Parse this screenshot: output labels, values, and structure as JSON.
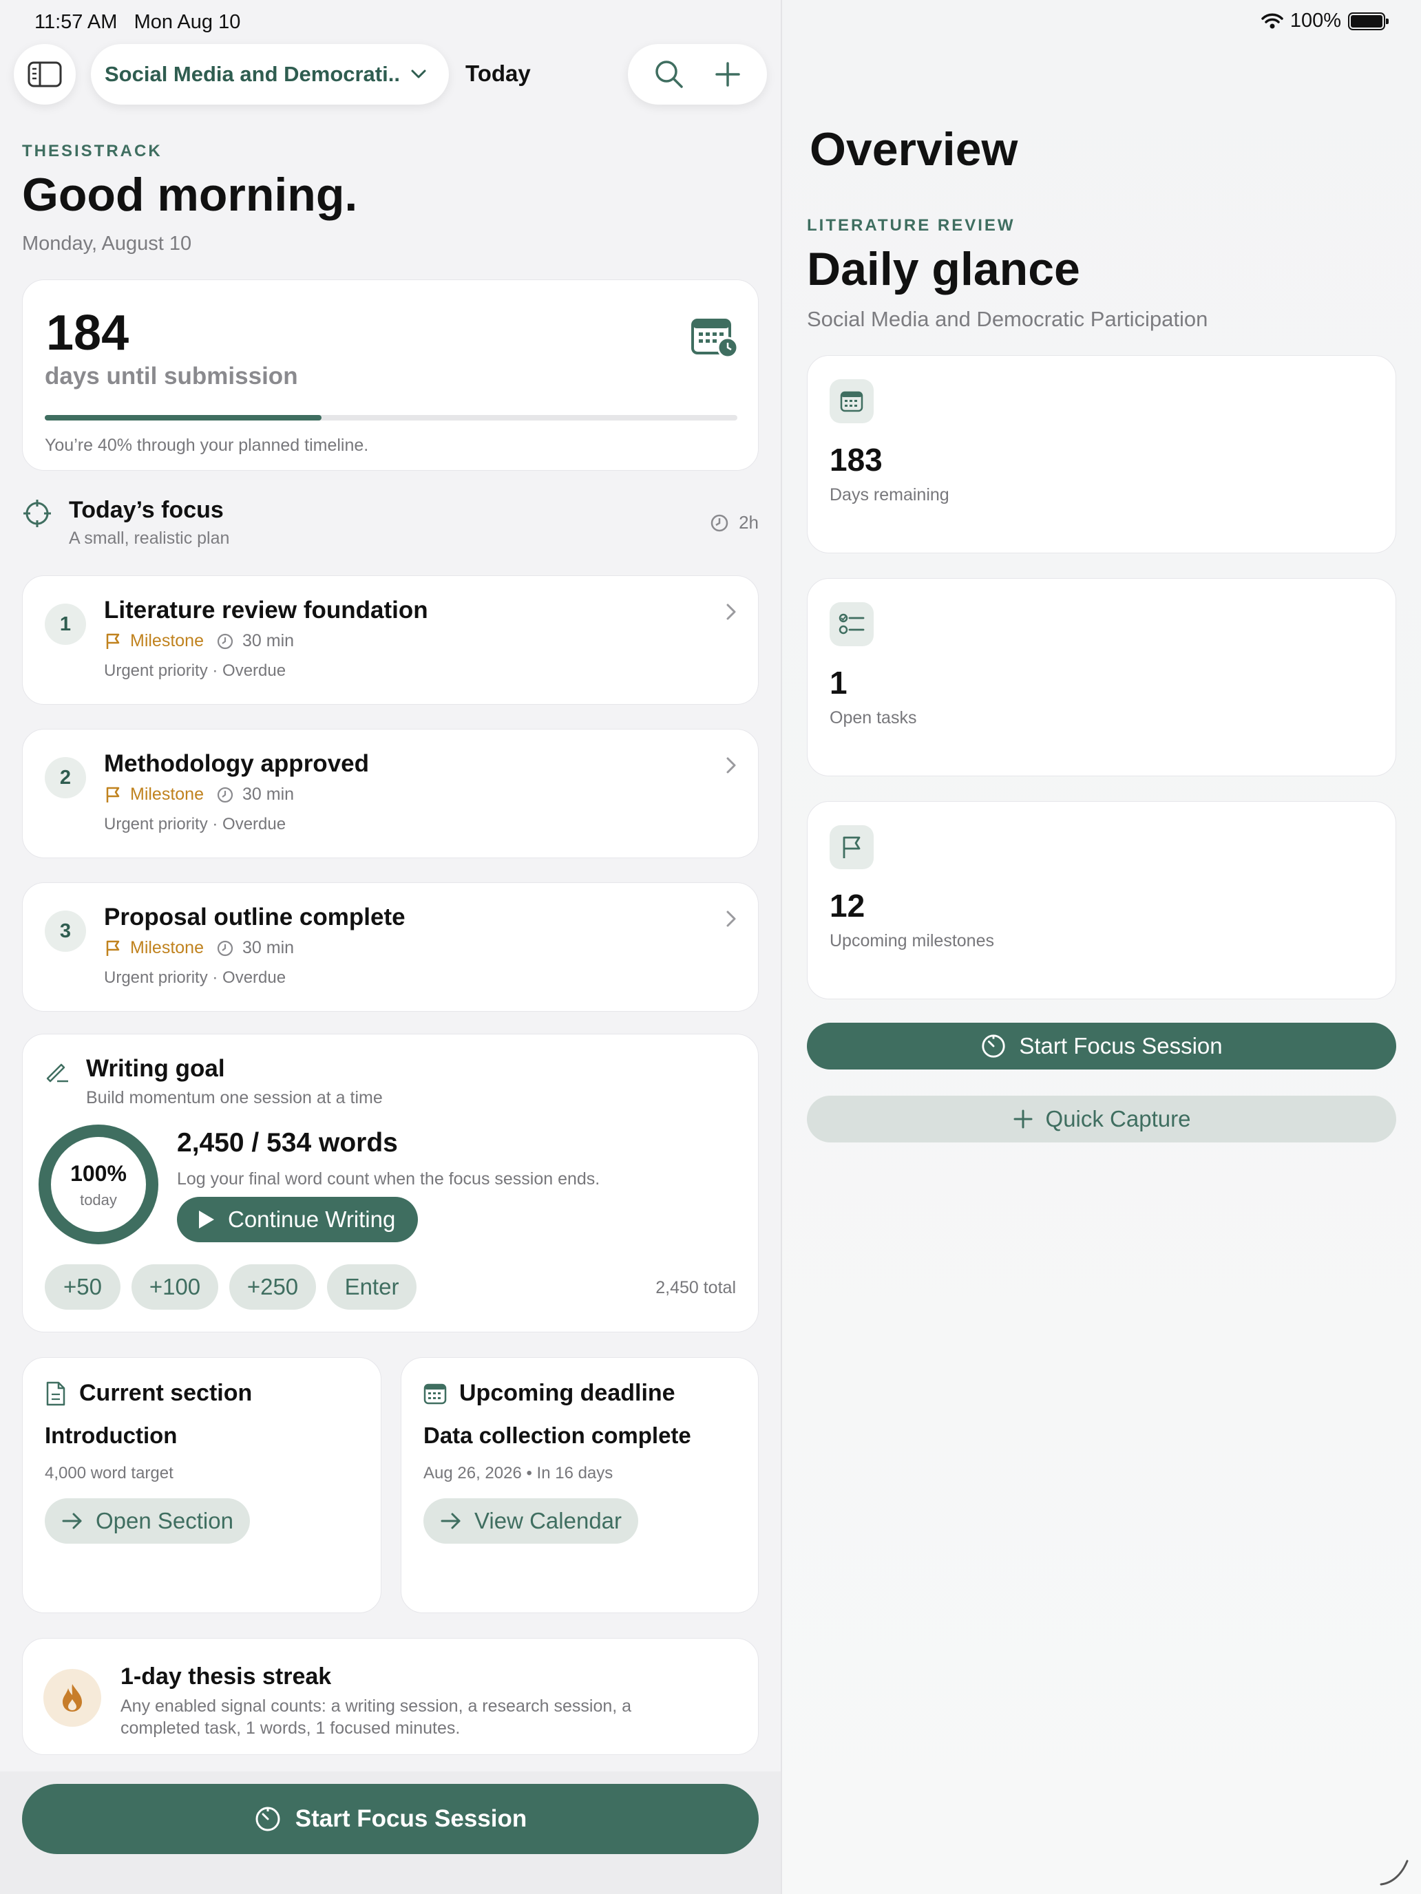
{
  "status": {
    "time": "11:57 AM",
    "date": "Mon Aug 10",
    "battery": "100%"
  },
  "nav": {
    "project": "Social Media and Democrati...",
    "title": "Today"
  },
  "greeting": {
    "app": "THESISTRACK",
    "headline": "Good morning.",
    "date": "Monday, August 10"
  },
  "countdown": {
    "days": "184",
    "label": "days until submission",
    "progress": 0.4,
    "note": "You’re 40% through your planned timeline."
  },
  "focus": {
    "title": "Today’s focus",
    "subtitle": "A small, realistic plan",
    "duration": "2h",
    "tasks": [
      {
        "num": "1",
        "title": "Literature review foundation",
        "type": "Milestone",
        "mins": "30 min",
        "priority": "Urgent priority · Overdue"
      },
      {
        "num": "2",
        "title": "Methodology approved",
        "type": "Milestone",
        "mins": "30 min",
        "priority": "Urgent priority · Overdue"
      },
      {
        "num": "3",
        "title": "Proposal outline complete",
        "type": "Milestone",
        "mins": "30 min",
        "priority": "Urgent priority · Overdue"
      }
    ]
  },
  "writing": {
    "title": "Writing goal",
    "subtitle": "Build momentum one session at a time",
    "percent": "100%",
    "percent_label": "today",
    "progress": 1.0,
    "words": "2,450 / 534 words",
    "log": "Log your final word count when the focus session ends.",
    "continue": "Continue Writing",
    "chips": [
      "+50",
      "+100",
      "+250",
      "Enter"
    ],
    "total": "2,450 total"
  },
  "current_section": {
    "header": "Current section",
    "name": "Introduction",
    "target": "4,000 word target",
    "button": "Open Section"
  },
  "deadline": {
    "header": "Upcoming deadline",
    "name": "Data collection complete",
    "date": "Aug 26, 2026 • In 16 days",
    "button": "View Calendar"
  },
  "streak": {
    "title": "1-day thesis streak",
    "body": "Any enabled signal counts: a writing session, a research session, a completed task, 1 words, 1 focused minutes."
  },
  "bottom": {
    "focus_button": "Start Focus Session"
  },
  "overview": {
    "title": "Overview",
    "eyebrow": "LITERATURE REVIEW",
    "headline": "Daily glance",
    "subtitle": "Social Media and Democratic Participation",
    "stats": [
      {
        "value": "183",
        "label": "Days remaining",
        "icon": "calendar-icon"
      },
      {
        "value": "1",
        "label": "Open tasks",
        "icon": "checklist-icon"
      },
      {
        "value": "12",
        "label": "Upcoming milestones",
        "icon": "flag-icon"
      }
    ],
    "focus_button": "Start Focus Session",
    "capture_button": "Quick Capture"
  },
  "colors": {
    "accent": "#3f6e60",
    "milestone": "#c0821e",
    "chip_bg": "#dfe6e2"
  }
}
